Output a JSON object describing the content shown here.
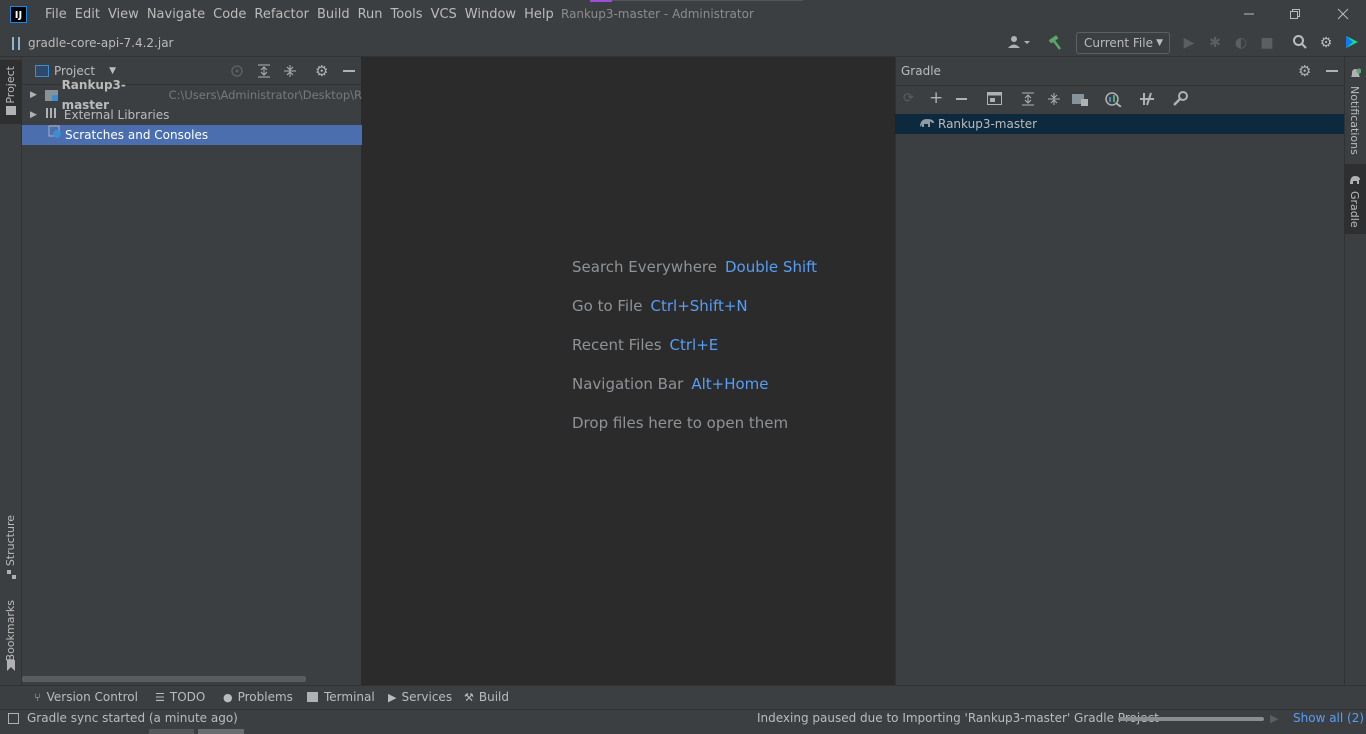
{
  "titlebar": {
    "logo_text": "IJ",
    "menu": [
      "File",
      "Edit",
      "View",
      "Navigate",
      "Code",
      "Refactor",
      "Build",
      "Run",
      "Tools",
      "VCS",
      "Window",
      "Help"
    ],
    "window_title": "Rankup3-master - Administrator"
  },
  "navbar": {
    "breadcrumb": "gradle-core-api-7.4.2.jar",
    "run_config": "Current File"
  },
  "left_stripe": {
    "project_tab": "Project",
    "structure_tab": "Structure",
    "bookmarks_tab": "Bookmarks"
  },
  "project_panel": {
    "title": "Project",
    "tree": [
      {
        "label": "Rankup3-master",
        "path": "C:\\Users\\Administrator\\Desktop\\Rank"
      },
      {
        "label": "External Libraries"
      },
      {
        "label": "Scratches and Consoles"
      }
    ]
  },
  "editor": {
    "hints": [
      {
        "text": "Search Everywhere",
        "key": "Double Shift"
      },
      {
        "text": "Go to File",
        "key": "Ctrl+Shift+N"
      },
      {
        "text": "Recent Files",
        "key": "Ctrl+E"
      },
      {
        "text": "Navigation Bar",
        "key": "Alt+Home"
      },
      {
        "text": "Drop files here to open them",
        "key": ""
      }
    ]
  },
  "gradle_panel": {
    "title": "Gradle",
    "tree": [
      {
        "label": "Rankup3-master"
      }
    ]
  },
  "right_stripe": {
    "notifications_tab": "Notifications",
    "gradle_tab": "Gradle"
  },
  "bottom_tabs": [
    "Version Control",
    "TODO",
    "Problems",
    "Terminal",
    "Services",
    "Build"
  ],
  "status_bar": {
    "left_text": "Gradle sync started (a minute ago)",
    "right_text": "Indexing paused due to Importing 'Rankup3-master' Gradle Project",
    "show_all": "Show all (2)"
  },
  "colors": {
    "background": "#2b2b2b",
    "panel": "#3c3f41",
    "selection": "#4b6eaf",
    "link": "#589df6",
    "build_green": "#59a869"
  }
}
